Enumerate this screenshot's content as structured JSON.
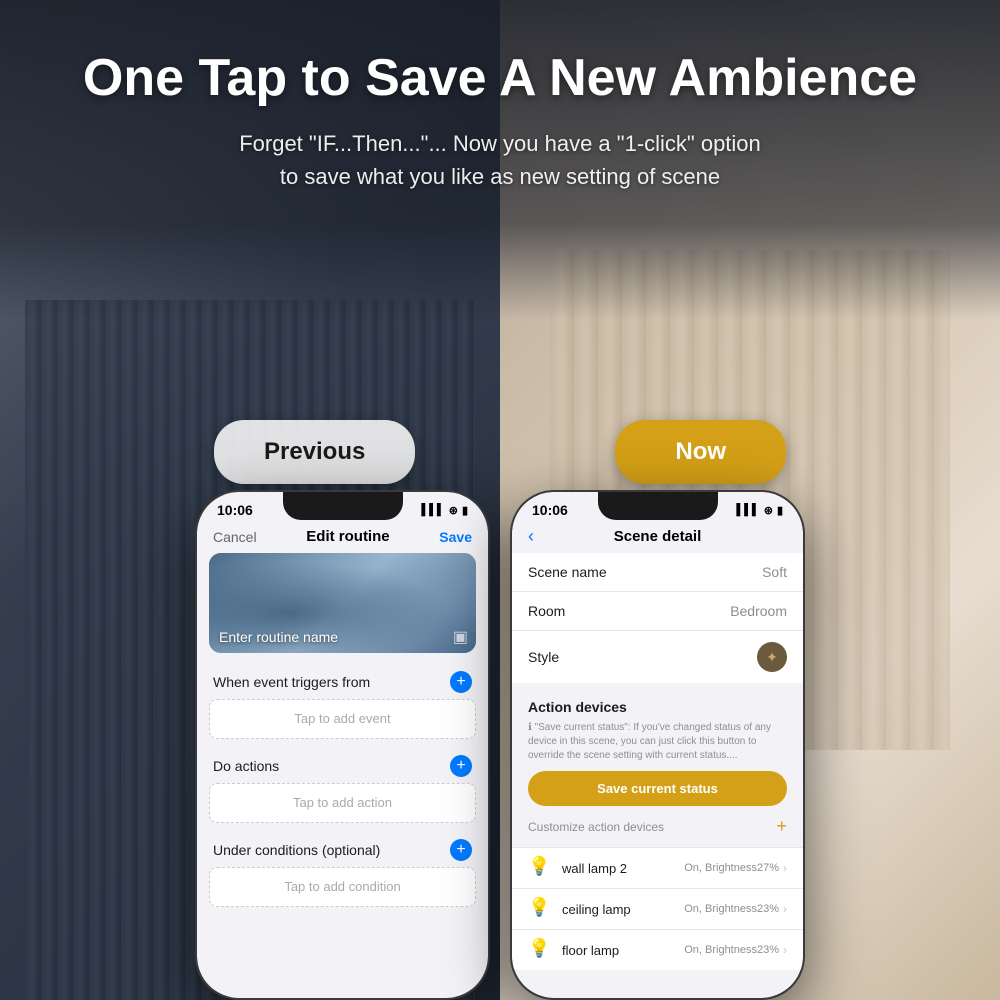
{
  "header": {
    "main_title": "One Tap to Save A New Ambience",
    "subtitle_line1": "Forget \"IF...Then...\"... Now you have a \"1-click\" option",
    "subtitle_line2": "to save what you like as new setting of scene"
  },
  "comparison": {
    "previous_label": "Previous",
    "now_label": "Now"
  },
  "left_phone": {
    "status_time": "10:06",
    "status_signal": "▌▌▌",
    "status_wifi": "WiFi",
    "status_battery": "🔋",
    "cancel_label": "Cancel",
    "title": "Edit routine",
    "save_label": "Save",
    "routine_name_placeholder": "Enter routine name",
    "when_event_label": "When event triggers from",
    "tap_event_placeholder": "Tap to add event",
    "do_actions_label": "Do actions",
    "tap_action_placeholder": "Tap to add action",
    "under_conditions_label": "Under conditions (optional)",
    "tap_condition_placeholder": "Tap to add condition"
  },
  "right_phone": {
    "status_time": "10:06",
    "title": "Scene detail",
    "scene_name_key": "Scene name",
    "scene_name_val": "Soft",
    "room_key": "Room",
    "room_val": "Bedroom",
    "style_key": "Style",
    "action_devices_title": "Action devices",
    "action_info": "\"Save current status\": If you've changed status of any device in this scene, you can just click this button to override the scene setting with current status....",
    "save_current_btn": "Save current status",
    "customize_label": "Customize action devices",
    "devices": [
      {
        "name": "wall lamp 2",
        "status": "On, Brightness27%"
      },
      {
        "name": "ceiling lamp",
        "status": "On, Brightness23%"
      },
      {
        "name": "floor lamp",
        "status": "On, Brightness23%"
      }
    ]
  }
}
